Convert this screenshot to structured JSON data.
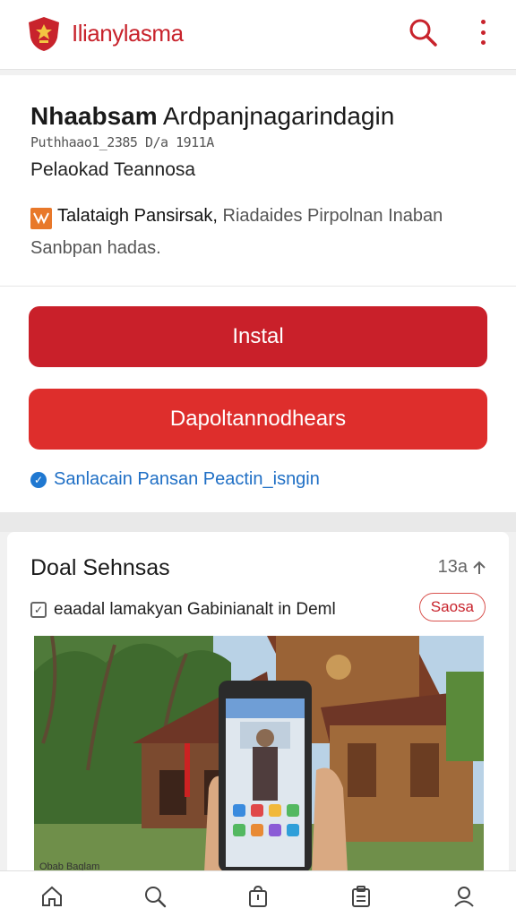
{
  "app": {
    "title": "Ilianylasma",
    "logo_icon": "shield-emblem-icon",
    "accent_color": "#c8232c"
  },
  "header_actions": {
    "search_icon": "search-icon",
    "more_icon": "more-vert-icon"
  },
  "info": {
    "heading_bold": "Nhaabsam",
    "heading_light": "Ardpanjnagarindagin",
    "meta": "Puthhaao1_2385 D/a 1911A",
    "subtitle": "Pelaokad Teannosa",
    "note_icon": "notice-icon",
    "note_bold": "Talataigh Pansirsak,",
    "note_muted": "Riadaides Pirpolnan Inaban",
    "note_line2": "Sanbpan hadas."
  },
  "actions": {
    "install_label": "Instal",
    "download_label": "Dapoltannodhears",
    "verify_text": "Sanlacain Pansan Peactin_isngin",
    "verify_color": "#1f6fc5"
  },
  "card": {
    "title": "Doal Sehnsas",
    "count": "13a",
    "count_icon": "arrow-up-icon",
    "row_text": "eaadal lamakyan Gabinianalt in Deml",
    "tag_label": "Saosa",
    "photo_caption": "Obab Baglam"
  },
  "nav": {
    "items": [
      {
        "icon": "home-icon"
      },
      {
        "icon": "search-icon"
      },
      {
        "icon": "bag-icon"
      },
      {
        "icon": "clipboard-icon"
      },
      {
        "icon": "profile-icon"
      }
    ]
  }
}
